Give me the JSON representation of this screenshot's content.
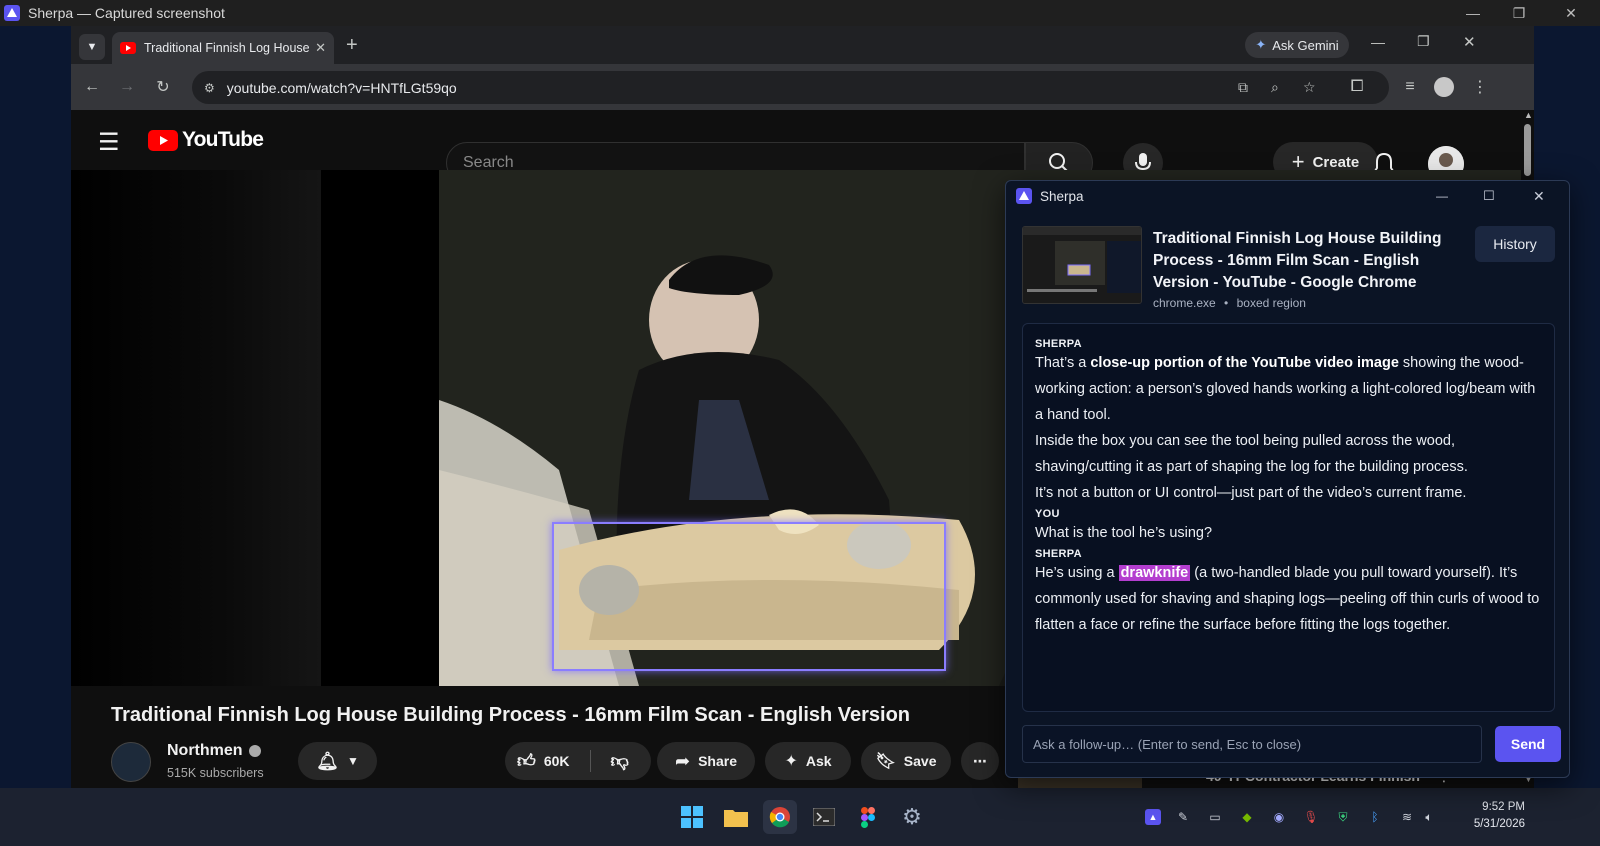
{
  "outer_window": {
    "title": "Sherpa — Captured screenshot"
  },
  "chrome": {
    "tab_title": "Traditional Finnish Log House B",
    "ask_gemini": "Ask Gemini",
    "url": "youtube.com/watch?v=HNTfLGt59qo"
  },
  "youtube": {
    "logo_text": "YouTube",
    "search_placeholder": "Search",
    "create_label": "Create",
    "video_title": "Traditional Finnish Log House Building Process - 16mm Film Scan - English Version",
    "channel_name": "Northmen",
    "subscribers": "515K subscribers",
    "likes": "60K",
    "share_label": "Share",
    "ask_label": "Ask",
    "save_label": "Save",
    "related_title": "40-Yr Contractor Learns Finnish"
  },
  "sherpa": {
    "window_title": "Sherpa",
    "context_title": "Traditional Finnish Log House Building Process - 16mm Film Scan - English Version - YouTube - Google Chrome",
    "context_process": "chrome.exe",
    "context_separator": "•",
    "context_region": "boxed region",
    "history_label": "History",
    "messages": [
      {
        "speaker": "SHERPA",
        "p1_pre": "That’s a ",
        "p1_bold": "close-up portion of the YouTube video image",
        "p1_post": " showing the wood-working action: a person’s gloved hands working a light-colored log/beam with a hand tool.",
        "p2": "Inside the box you can see the tool being pulled across the wood, shaving/cutting it as part of shaping the log for the building process.",
        "p3": "It’s not a button or UI control—just part of the video’s current frame."
      },
      {
        "speaker": "YOU",
        "text": "What is the tool he’s using?"
      },
      {
        "speaker": "SHERPA",
        "pre": "He’s using a ",
        "highlight": "drawknife",
        "post": " (a two-handled blade you pull toward yourself). It’s commonly used for shaving and shaping logs—peeling off thin curls of wood to flatten a face or refine the surface before fitting the logs together."
      }
    ],
    "followup_placeholder": "Ask a follow-up…   (Enter to send, Esc to close)",
    "send_label": "Send"
  },
  "taskbar": {
    "time": "9:52 PM",
    "date": "5/31/2026"
  },
  "colors": {
    "accent": "#5b54f0",
    "highlight": "#b43ecf",
    "youtube_red": "#ff0000",
    "selection_box": "#7b6cff"
  }
}
